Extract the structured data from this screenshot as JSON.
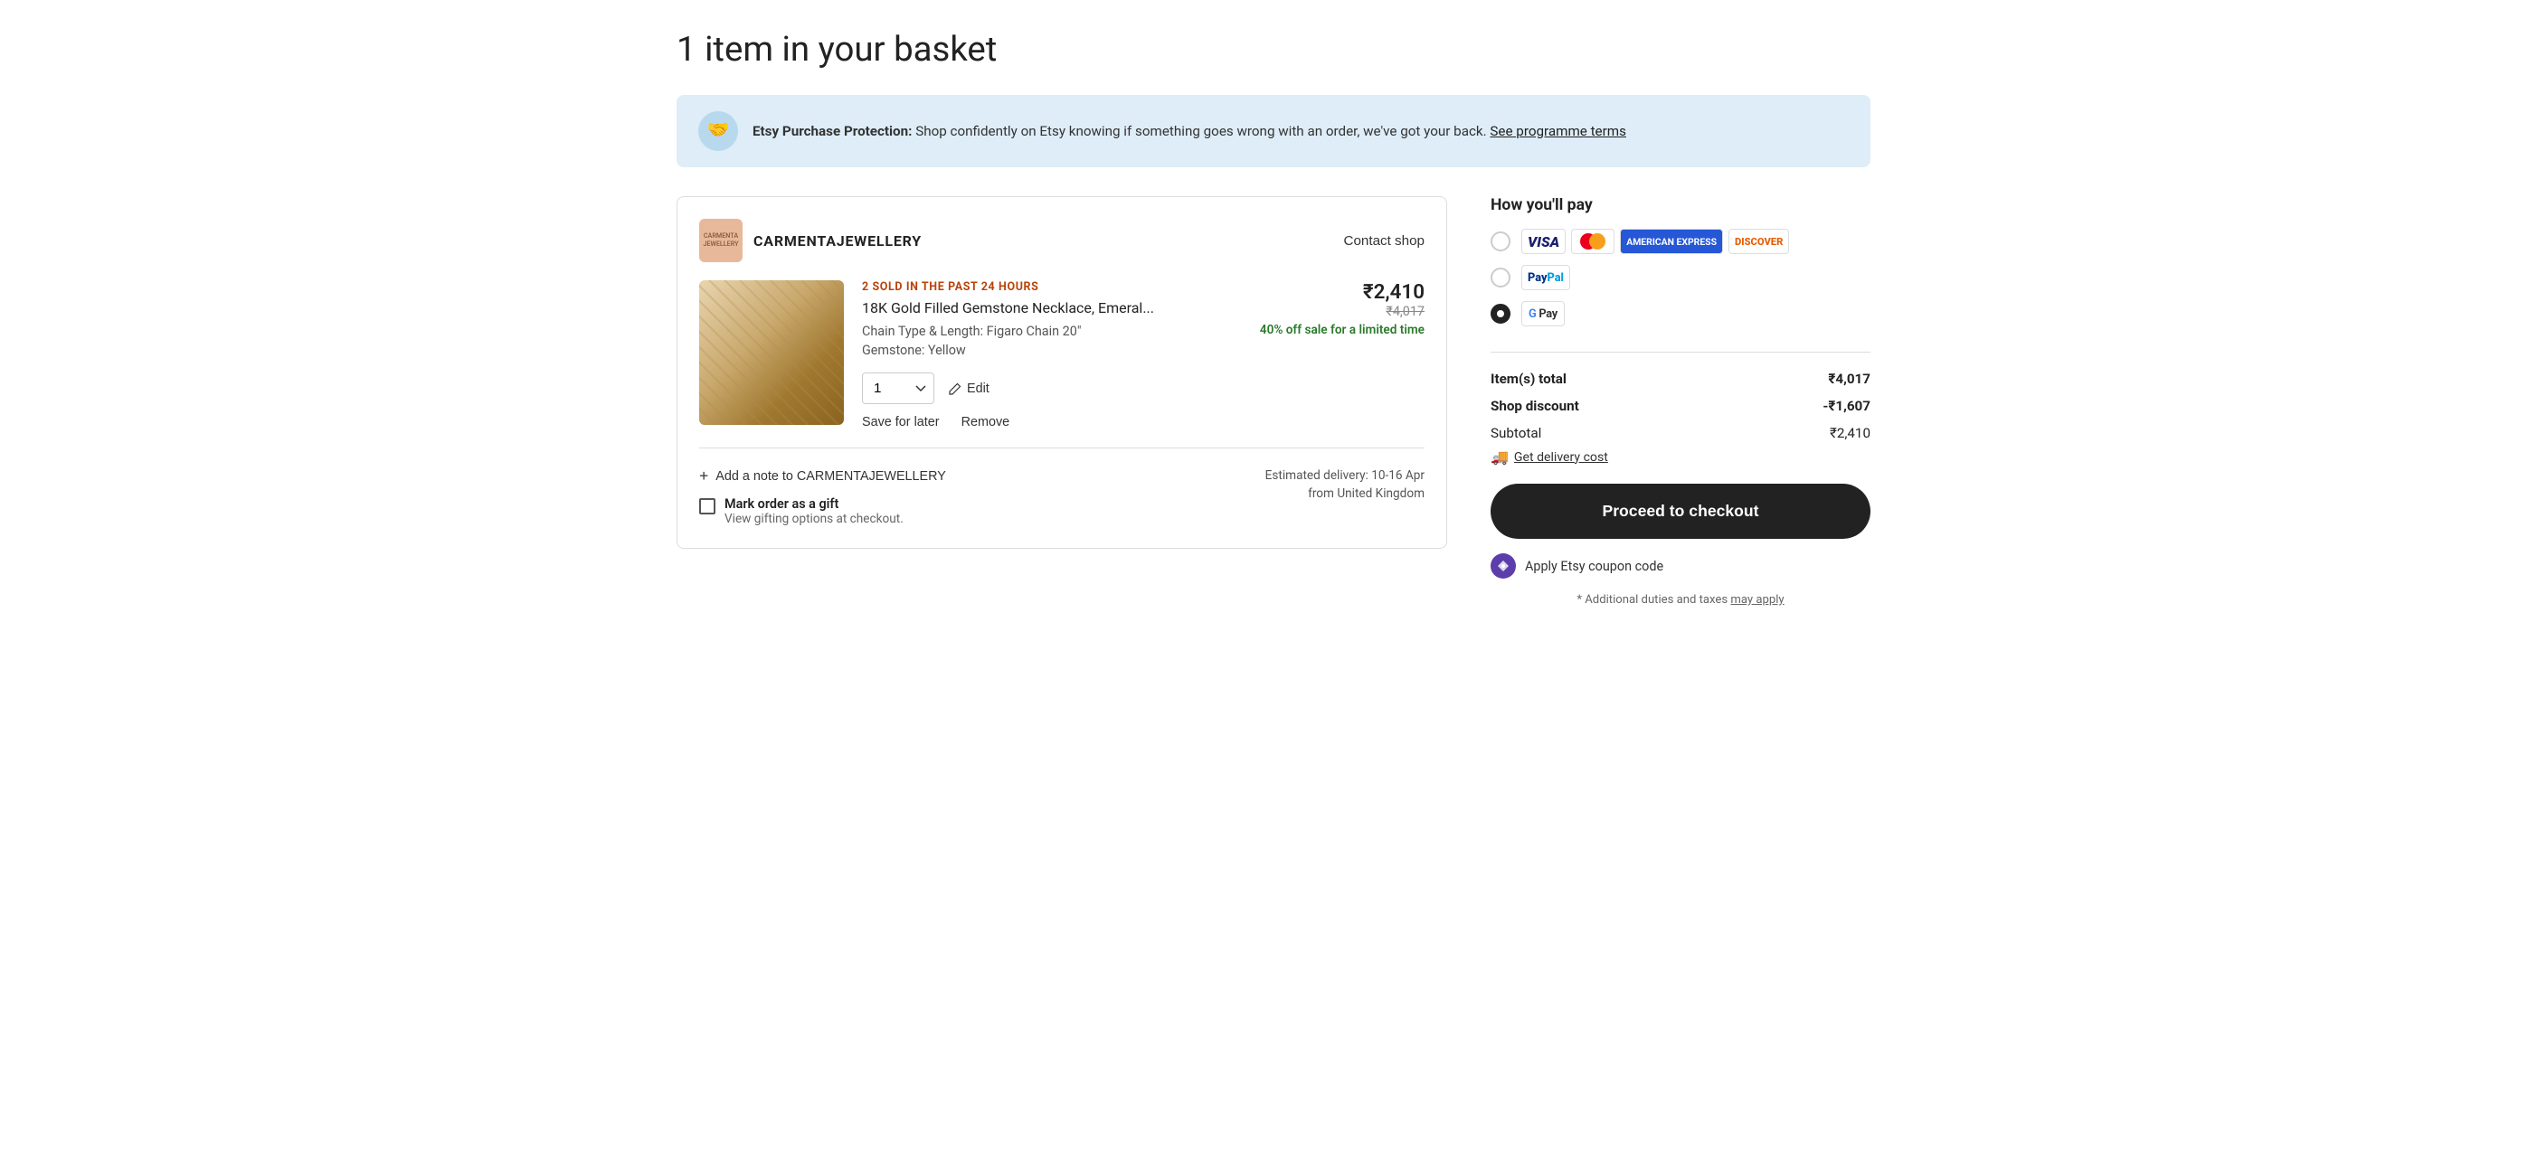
{
  "page": {
    "title": "1 item in your basket"
  },
  "banner": {
    "text_bold": "Etsy Purchase Protection:",
    "text": " Shop confidently on Etsy knowing if something goes wrong with an order, we've got your back.",
    "link": "See programme terms"
  },
  "shop": {
    "name": "CARMENTAJEWELLERY",
    "avatar_text": "CARMENTA JEWELLERY",
    "contact_label": "Contact shop",
    "sold_badge": "2 SOLD IN THE PAST 24 HOURS",
    "item_name": "18K Gold Filled Gemstone Necklace, Emeral...",
    "variant1": "Chain Type & Length: Figaro Chain 20\"",
    "variant2": "Gemstone: Yellow",
    "current_price": "₹2,410",
    "original_price": "₹4,017",
    "discount_text": "40% off sale for a limited time",
    "quantity": "1",
    "edit_label": "Edit",
    "save_for_later": "Save for later",
    "remove": "Remove",
    "add_note_label": "Add a note to CARMENTAJEWELLERY",
    "gift_label": "Mark order as a gift",
    "gift_sublabel": "View gifting options at checkout.",
    "delivery_label": "Estimated delivery: 10-16 Apr",
    "delivery_sublabel": "from United Kingdom"
  },
  "payment": {
    "title": "How you'll pay",
    "options": [
      {
        "id": "cards",
        "selected": false,
        "type": "cards"
      },
      {
        "id": "paypal",
        "selected": false,
        "type": "paypal"
      },
      {
        "id": "gpay",
        "selected": true,
        "type": "gpay"
      }
    ]
  },
  "summary": {
    "items_total_label": "Item(s) total",
    "items_total_value": "₹4,017",
    "shop_discount_label": "Shop discount",
    "shop_discount_value": "-₹1,607",
    "subtotal_label": "Subtotal",
    "subtotal_value": "₹2,410",
    "delivery_link": "Get delivery cost",
    "checkout_label": "Proceed to checkout",
    "coupon_label": "Apply Etsy coupon code",
    "taxes_note": "* Additional duties and taxes",
    "taxes_link": "may apply"
  }
}
